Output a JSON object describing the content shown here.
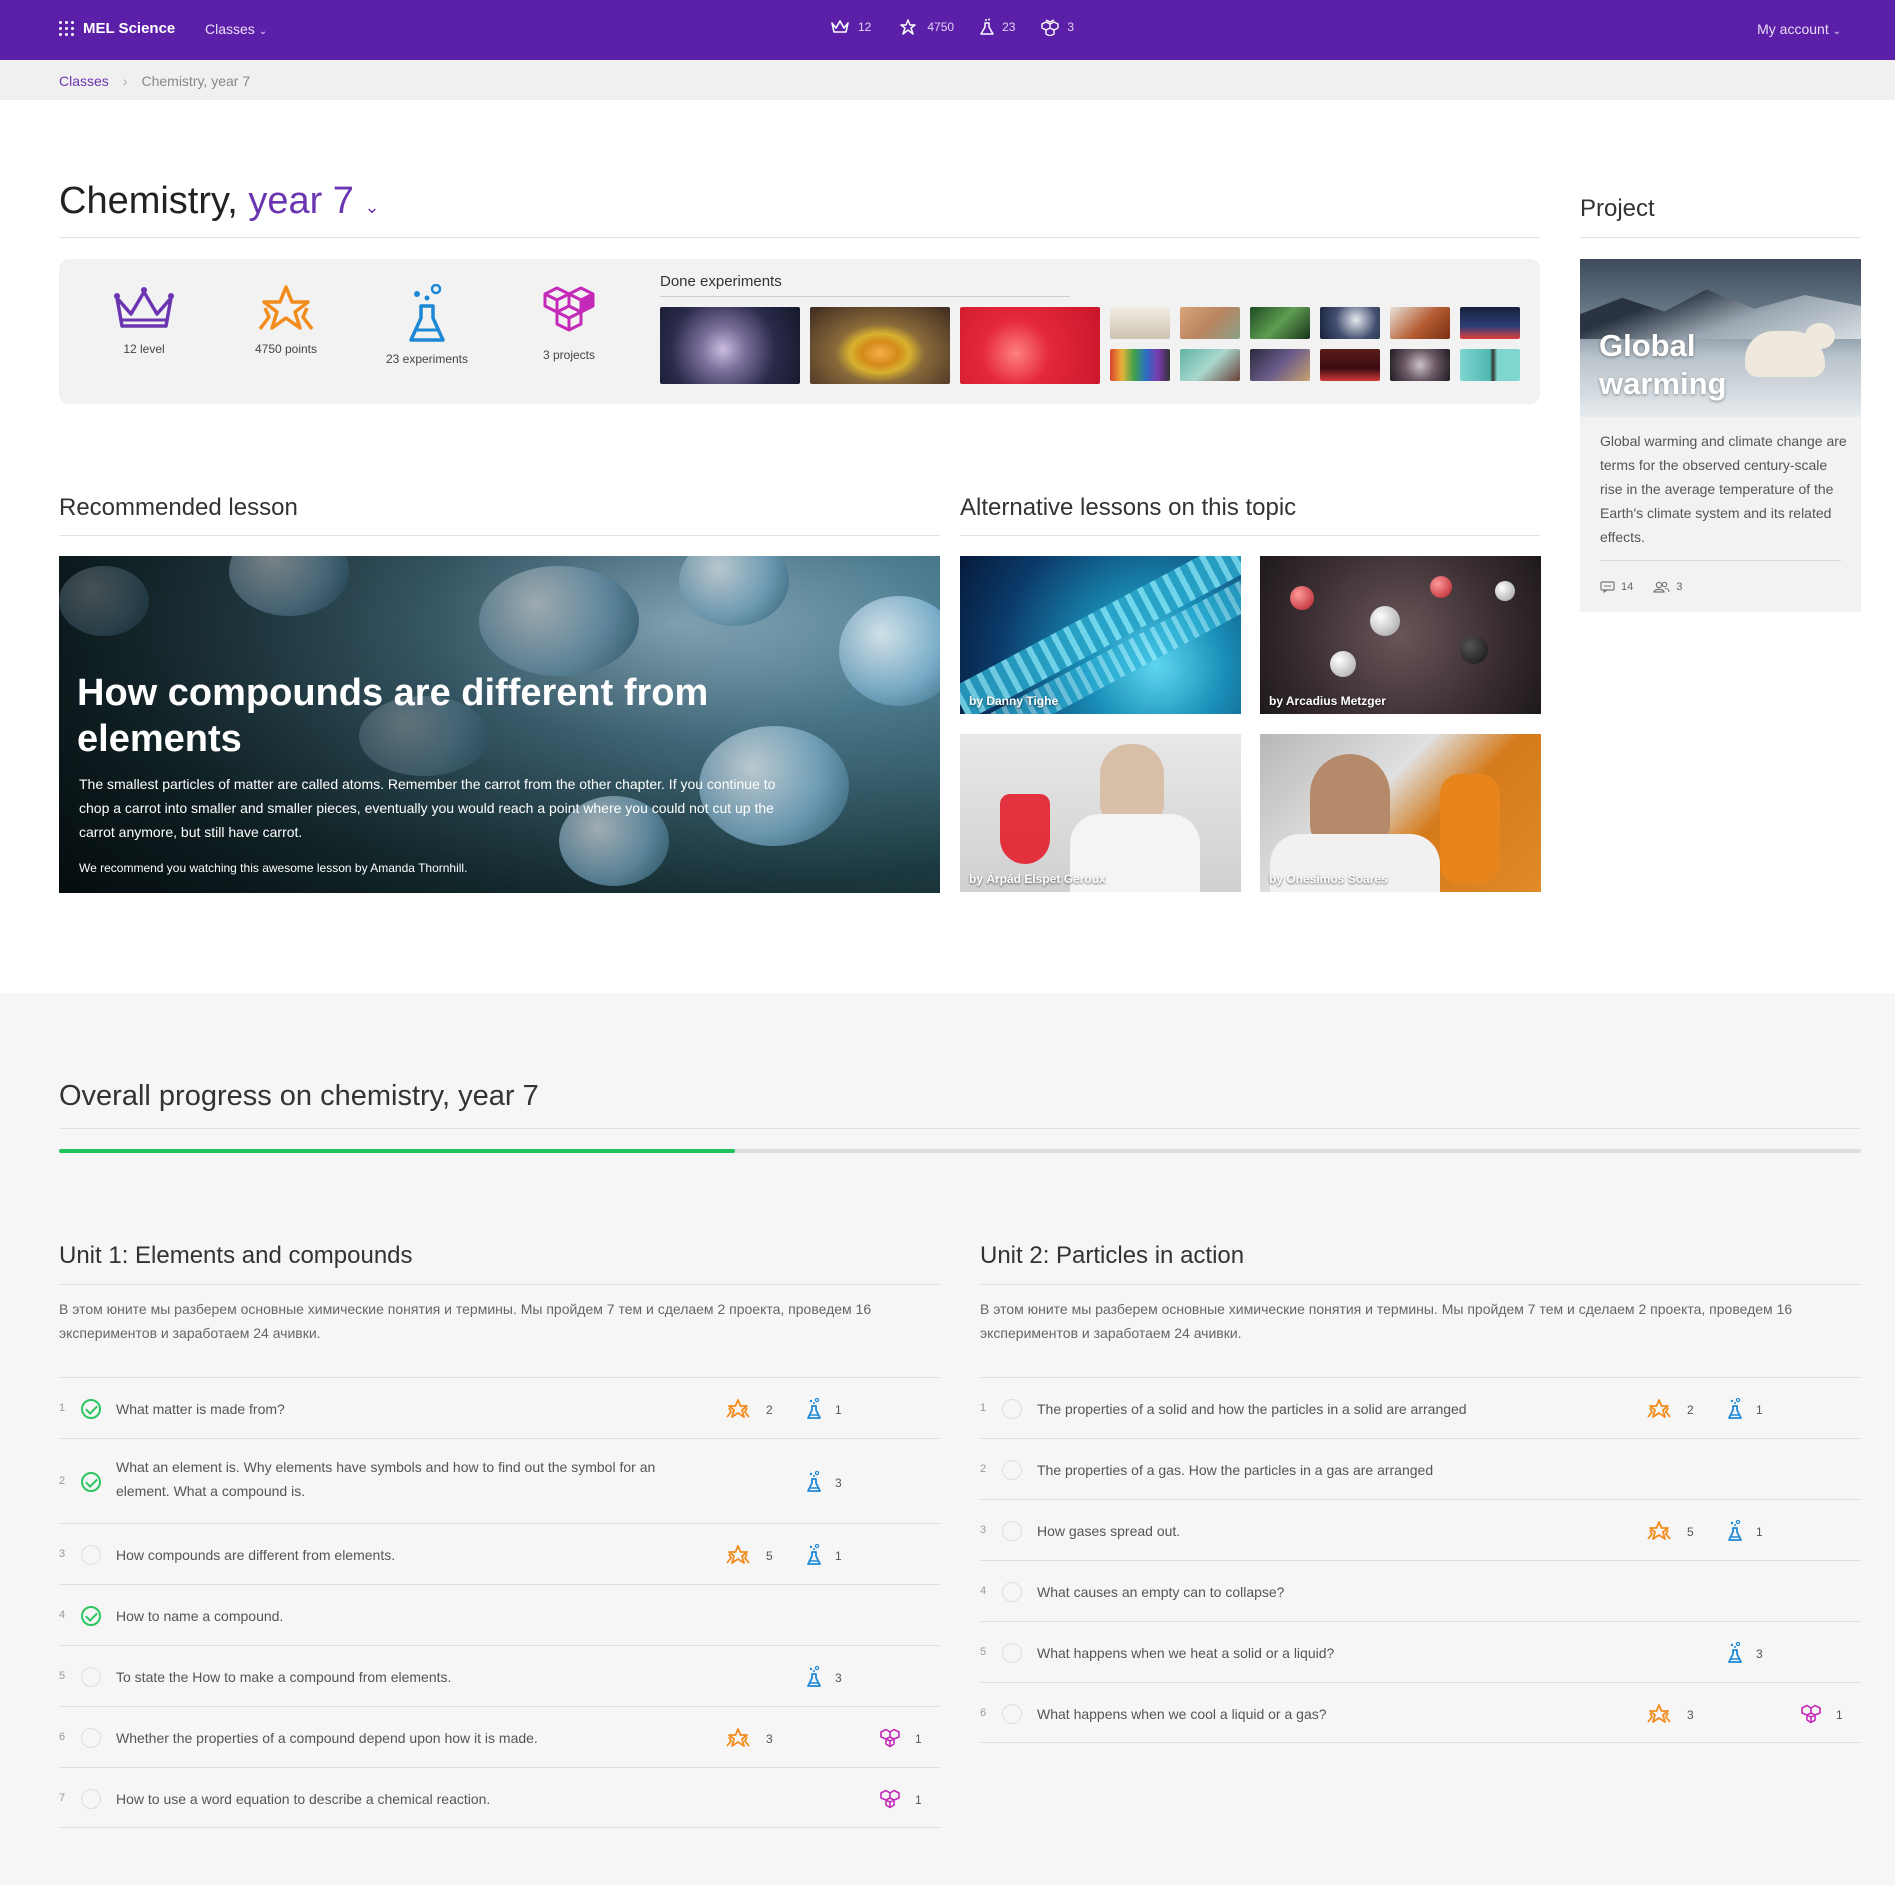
{
  "nav": {
    "brand": "MEL Science",
    "classes_label": "Classes",
    "stats": [
      {
        "icon": "crown-icon",
        "value": "12"
      },
      {
        "icon": "stars-icon",
        "value": "4750"
      },
      {
        "icon": "flask-icon",
        "value": "23"
      },
      {
        "icon": "cubes-icon",
        "value": "3"
      }
    ],
    "account_label": "My account"
  },
  "breadcrumb": {
    "root": "Classes",
    "separator": "›",
    "current": "Chemistry, year 7"
  },
  "page": {
    "title": "Chemistry,",
    "year": "year 7"
  },
  "summary": {
    "items": [
      {
        "icon": "crown-icon",
        "label": "12 level"
      },
      {
        "icon": "stars-icon",
        "label": "4750 points"
      },
      {
        "icon": "flask-icon",
        "label": "23 experiments"
      },
      {
        "icon": "cubes-icon",
        "label": "3 projects"
      }
    ],
    "done_label": "Done experiments"
  },
  "project": {
    "heading": "Project",
    "image_title_line1": "Global",
    "image_title_line2": "warming",
    "description": "Global warming and climate change are terms for the observed century-scale rise in the average temperature of the Earth's climate system and its related effects.",
    "comments": "14",
    "participants": "3"
  },
  "recommended": {
    "heading": "Recommended lesson",
    "title": "How compounds are different from elements",
    "description": "The smallest particles of matter are called atoms. Remember the carrot from the other chapter. If you continue to chop a carrot into smaller and smaller pieces, eventually you would reach a point where you could not cut up the carrot anymore, but still have carrot.",
    "note": "We recommend you watching this awesome lesson by Amanda Thornhill."
  },
  "alternatives": {
    "heading": "Alternative lessons on this topic",
    "items": [
      {
        "author": "by Danny Tighe"
      },
      {
        "author": "by Arcadius Metzger"
      },
      {
        "author": "by Árpád Elspet Geroux"
      },
      {
        "author": "by Onesimos Soares"
      }
    ]
  },
  "progress": {
    "title": "Overall progress on chemistry, year 7",
    "fraction": 0.375,
    "color": "#1fc35c"
  },
  "units": [
    {
      "title": "Unit 1: Elements and compounds",
      "description": "В этом юните мы разберем основные химические понятия и термины. Мы пройдем 7 тем и сделаем 2 проекта, проведем 16 экспериментов и заработаем 24 ачивки.",
      "lessons": [
        {
          "n": "1",
          "done": true,
          "text": "What matter is made from?",
          "stars": "2",
          "flasks": "1",
          "cubes": ""
        },
        {
          "n": "2",
          "done": true,
          "text": "What an element is. Why elements have symbols and how to find out the symbol for an element. What a compound is.",
          "stars": "",
          "flasks": "3",
          "cubes": ""
        },
        {
          "n": "3",
          "done": false,
          "text": "How compounds are different from elements.",
          "stars": "5",
          "flasks": "1",
          "cubes": ""
        },
        {
          "n": "4",
          "done": true,
          "text": "How to name a compound.",
          "stars": "",
          "flasks": "",
          "cubes": ""
        },
        {
          "n": "5",
          "done": false,
          "text": "To state the How to make a compound from elements.",
          "stars": "",
          "flasks": "3",
          "cubes": ""
        },
        {
          "n": "6",
          "done": false,
          "text": "Whether the properties of a compound depend upon how it is made.",
          "stars": "3",
          "flasks": "",
          "cubes": "1"
        },
        {
          "n": "7",
          "done": false,
          "text": "How to use a word equation to describe a chemical reaction.",
          "stars": "",
          "flasks": "",
          "cubes": "1"
        }
      ]
    },
    {
      "title": "Unit 2: Particles in action",
      "description": "В этом юните мы разберем основные химические понятия и термины. Мы пройдем 7 тем и сделаем 2 проекта, проведем 16 экспериментов и заработаем 24 ачивки.",
      "lessons": [
        {
          "n": "1",
          "done": false,
          "text": "The properties of a solid and how the particles in a solid are arranged",
          "stars": "2",
          "flasks": "1",
          "cubes": ""
        },
        {
          "n": "2",
          "done": false,
          "text": "The properties of a gas. How the particles in a gas are arranged",
          "stars": "",
          "flasks": "",
          "cubes": ""
        },
        {
          "n": "3",
          "done": false,
          "text": "How gases spread out.",
          "stars": "5",
          "flasks": "1",
          "cubes": ""
        },
        {
          "n": "4",
          "done": false,
          "text": "What causes an empty can to collapse?",
          "stars": "",
          "flasks": "",
          "cubes": ""
        },
        {
          "n": "5",
          "done": false,
          "text": "What happens when we heat a solid or a liquid?",
          "stars": "",
          "flasks": "3",
          "cubes": ""
        },
        {
          "n": "6",
          "done": false,
          "text": "What happens when we cool a liquid or a gas?",
          "stars": "3",
          "flasks": "",
          "cubes": "1"
        }
      ]
    }
  ],
  "colors": {
    "brand": "#5c20a8",
    "accent_purple": "#6a35b0",
    "star_orange": "#f28c1c",
    "flask_blue": "#1e88d6",
    "cube_magenta": "#c429b8",
    "success_green": "#2ec45f"
  }
}
